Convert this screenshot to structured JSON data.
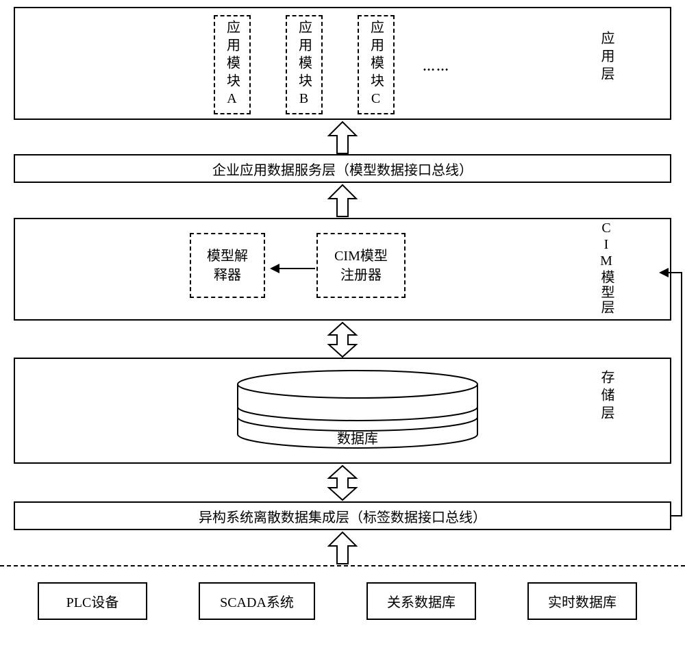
{
  "appLayer": {
    "label": "应用层",
    "modA": "应用模块A",
    "modB": "应用模块B",
    "modC": "应用模块C",
    "ellipsis": "……"
  },
  "serviceLayer": {
    "label": "企业应用数据服务层（模型数据接口总线）"
  },
  "cimLayer": {
    "label": "CIM模型层",
    "interp_l1": "模型解",
    "interp_l2": "释器",
    "reg_l1": "CIM模型",
    "reg_l2": "注册器"
  },
  "storageLayer": {
    "label": "存储层",
    "db": "数据库"
  },
  "integrationLayer": {
    "label": "异构系统离散数据集成层（标签数据接口总线）"
  },
  "sources": {
    "plc": "PLC设备",
    "scada": "SCADA系统",
    "reldb": "关系数据库",
    "rtdb": "实时数据库"
  }
}
